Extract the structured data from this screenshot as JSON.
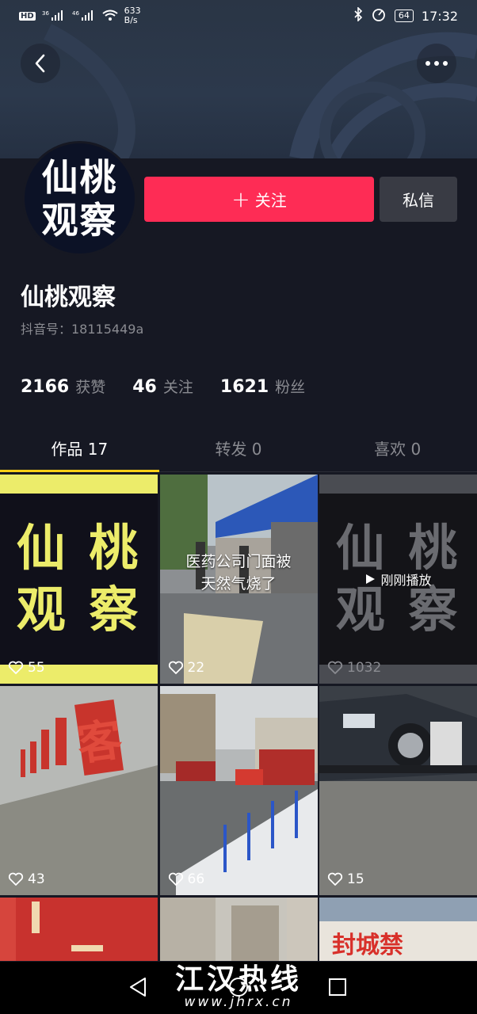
{
  "status_bar": {
    "hd": "HD",
    "net1": "36",
    "net2": "46",
    "speed_value": "633",
    "speed_unit": "B/s",
    "battery": "64",
    "time": "17:32"
  },
  "profile": {
    "avatar_line1": "仙桃",
    "avatar_line2": "观察",
    "name": "仙桃观察",
    "douyin_id": "抖音号：18115449a",
    "follow_label": "关注",
    "message_label": "私信"
  },
  "stats": [
    {
      "num": "2166",
      "label": "获赞"
    },
    {
      "num": "46",
      "label": "关注"
    },
    {
      "num": "1621",
      "label": "粉丝"
    }
  ],
  "tabs": [
    {
      "label": "作品 17"
    },
    {
      "label": "转发 0"
    },
    {
      "label": "喜欢 0"
    }
  ],
  "videos": [
    {
      "likes": "55",
      "logo_line1": "仙 桃",
      "logo_line2": "观 察"
    },
    {
      "likes": "22",
      "caption_line1": "医药公司门面被",
      "caption_line2": "天然气烧了"
    },
    {
      "likes": "1032",
      "logo_line1": "仙 桃",
      "logo_line2": "观 察",
      "played_label": "刚刚播放"
    },
    {
      "likes": "43",
      "sign_text": "客"
    },
    {
      "likes": "66"
    },
    {
      "likes": "15"
    },
    {
      "likes": ""
    },
    {
      "likes": ""
    },
    {
      "likes": "",
      "sign_text": "封城禁"
    }
  ],
  "watermark": {
    "main": "江汉热线",
    "sub": "www.jhrx.cn"
  },
  "colors": {
    "follow": "#fe2c55",
    "tab_indicator": "#face15",
    "background": "#161823"
  }
}
